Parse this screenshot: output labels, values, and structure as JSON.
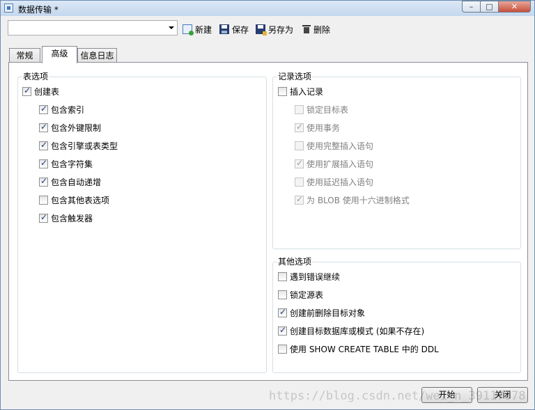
{
  "window": {
    "title": "数据传输 *",
    "minimize_label": "–",
    "maximize_label": "□",
    "close_label": "✕"
  },
  "toolbar": {
    "profile_value": "",
    "new_label": "新建",
    "save_label": "保存",
    "save_as_label": "另存为",
    "delete_label": "删除"
  },
  "tabs": [
    {
      "label": "常规",
      "active": false
    },
    {
      "label": "高级",
      "active": true
    },
    {
      "label": "信息日志",
      "active": false
    }
  ],
  "table_options": {
    "legend": "表选项",
    "create_table": {
      "label": "创建表",
      "checked": true
    },
    "items": [
      {
        "label": "包含索引",
        "checked": true
      },
      {
        "label": "包含外键限制",
        "checked": true
      },
      {
        "label": "包含引擎或表类型",
        "checked": true
      },
      {
        "label": "包含字符集",
        "checked": true
      },
      {
        "label": "包含自动递增",
        "checked": true
      },
      {
        "label": "包含其他表选项",
        "checked": false
      },
      {
        "label": "包含触发器",
        "checked": true
      }
    ]
  },
  "record_options": {
    "legend": "记录选项",
    "insert_records": {
      "label": "插入记录",
      "checked": false
    },
    "items": [
      {
        "label": "锁定目标表",
        "checked": false,
        "disabled": true
      },
      {
        "label": "使用事务",
        "checked": true,
        "disabled": true
      },
      {
        "label": "使用完整插入语句",
        "checked": false,
        "disabled": true
      },
      {
        "label": "使用扩展插入语句",
        "checked": true,
        "disabled": true
      },
      {
        "label": "使用延迟插入语句",
        "checked": false,
        "disabled": true
      },
      {
        "label": "为 BLOB 使用十六进制格式",
        "checked": true,
        "disabled": true
      }
    ]
  },
  "other_options": {
    "legend": "其他选项",
    "items": [
      {
        "label": "遇到错误继续",
        "checked": false
      },
      {
        "label": "锁定源表",
        "checked": false
      },
      {
        "label": "创建前删除目标对象",
        "checked": true
      },
      {
        "label": "创建目标数据库或模式 (如果不存在)",
        "checked": true
      },
      {
        "label": "使用 SHOW CREATE TABLE 中的 DDL",
        "checked": false
      }
    ]
  },
  "buttons": {
    "start_label": "开始",
    "close_label": "关闭"
  },
  "watermark": "https://blog.csdn.net/wei_n_39117878",
  "colors": {
    "window_bg": "#f0f0f0",
    "titlebar": "#c4d7ee",
    "check": "#1d3a78"
  }
}
